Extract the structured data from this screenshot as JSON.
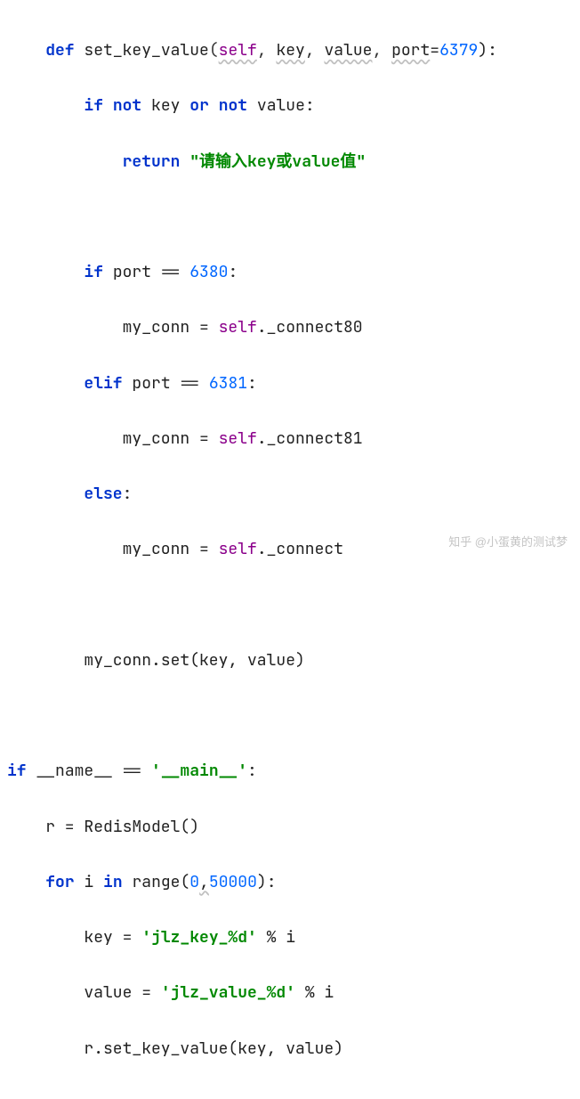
{
  "code": {
    "l1": {
      "def": "def",
      "fname": "set_key_value",
      "self": "self",
      "p1": "key",
      "p2": "value",
      "p3": "port",
      "eq": "=",
      "port": "6379",
      "colon": "):"
    },
    "l2": {
      "if": "if",
      "not1": "not",
      "k": "key",
      "or": "or",
      "not2": "not",
      "v": "value:"
    },
    "l3": {
      "ret": "return",
      "s": "\"请输入key或value值\""
    },
    "l4": {
      "if": "if",
      "var": "port ==",
      "num": "6380",
      "colon": ":"
    },
    "l5": {
      "txt": "my_conn = ",
      "self": "self",
      "attr": "._connect80"
    },
    "l6": {
      "elif": "elif",
      "var": "port ==",
      "num": "6381",
      "colon": ":"
    },
    "l7": {
      "txt": "my_conn = ",
      "self": "self",
      "attr": "._connect81"
    },
    "l8": {
      "else": "else",
      "colon": ":"
    },
    "l9": {
      "txt": "my_conn = ",
      "self": "self",
      "attr": "._connect"
    },
    "l10": {
      "txt": "my_conn.set(key, value)"
    },
    "l11": {
      "if": "if",
      "dname": "__name__",
      "eq": " == ",
      "s": "'__main__'",
      "colon": ":"
    },
    "l12": {
      "txt": "r = RedisModel()"
    },
    "l13": {
      "for": "for",
      "i": "i",
      "in": "in",
      "range": "range(",
      "a": "0",
      "comma": ",",
      "b": "50000",
      "close": "):"
    },
    "l14": {
      "k": "key = ",
      "s": "'jlz_key_%d'",
      "rest": " % i"
    },
    "l15": {
      "k": "value = ",
      "s": "'jlz_value_%d'",
      "rest": " % i"
    },
    "l16": {
      "txt": "r.set_key_value(key, value)"
    }
  },
  "watermark": "知乎 @小蛋黄的测试梦"
}
